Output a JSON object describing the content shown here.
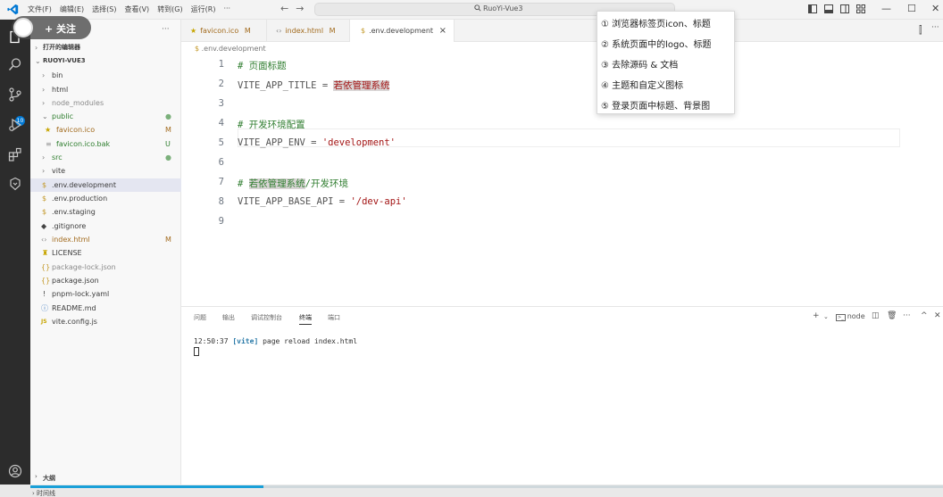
{
  "titlebar": {
    "menu": [
      "文件(F)",
      "编辑(E)",
      "选择(S)",
      "查看(V)",
      "转到(G)",
      "运行(R)",
      "···"
    ],
    "nav_back": "←",
    "nav_forward": "→",
    "search_label": "RuoYi-Vue3"
  },
  "follow_overlay": {
    "label": "+ 关注"
  },
  "sidebar": {
    "open_editors_label": "打开的编辑器",
    "project_label": "RUOYI-VUE3",
    "items": [
      {
        "label": "bin",
        "icon": "chevron-right",
        "status": ""
      },
      {
        "label": "html",
        "icon": "chevron-right",
        "status": ""
      },
      {
        "label": "node_modules",
        "icon": "chevron-right",
        "status": ""
      },
      {
        "label": "public",
        "icon": "chevron-down",
        "status": "●"
      },
      {
        "label": "favicon.ico",
        "icon": "star",
        "status": "M"
      },
      {
        "label": "favicon.ico.bak",
        "icon": "lines",
        "status": "U"
      },
      {
        "label": "src",
        "icon": "chevron-right",
        "status": "●"
      },
      {
        "label": "vite",
        "icon": "chevron-right",
        "status": ""
      },
      {
        "label": ".env.development",
        "icon": "dollar",
        "status": ""
      },
      {
        "label": ".env.production",
        "icon": "dollar",
        "status": ""
      },
      {
        "label": ".env.staging",
        "icon": "dollar",
        "status": ""
      },
      {
        "label": ".gitignore",
        "icon": "diamond",
        "status": ""
      },
      {
        "label": "index.html",
        "icon": "html",
        "status": "M"
      },
      {
        "label": "LICENSE",
        "icon": "license",
        "status": ""
      },
      {
        "label": "package-lock.json",
        "icon": "braces",
        "status": ""
      },
      {
        "label": "package.json",
        "icon": "braces",
        "status": ""
      },
      {
        "label": "pnpm-lock.yaml",
        "icon": "exclaim",
        "status": ""
      },
      {
        "label": "README.md",
        "icon": "info",
        "status": ""
      },
      {
        "label": "vite.config.js",
        "icon": "js",
        "status": ""
      }
    ],
    "outline_label": "大纲",
    "timeline_label": "时间线",
    "more": "···"
  },
  "tabs": [
    {
      "label": "favicon.ico",
      "status": "M"
    },
    {
      "label": "index.html",
      "status": "M"
    },
    {
      "label": ".env.development",
      "status": "×"
    }
  ],
  "breadcrumb": ".env.development",
  "editor": {
    "lines": [
      {
        "n": "1",
        "comment": "# 页面标题"
      },
      {
        "n": "2",
        "key": "VITE_APP_TITLE = ",
        "value": "若依管理系统"
      },
      {
        "n": "3"
      },
      {
        "n": "4",
        "comment": "# 开发环境配置"
      },
      {
        "n": "5",
        "key": "VITE_APP_ENV = ",
        "value": "'development'"
      },
      {
        "n": "6"
      },
      {
        "n": "7",
        "comment_pre": "# ",
        "comment_hl": "若依管理系统",
        "comment_post": "/开发环境"
      },
      {
        "n": "8",
        "key": "VITE_APP_BASE_API = ",
        "value": "'/dev-api'"
      },
      {
        "n": "9"
      }
    ]
  },
  "popup": {
    "items": [
      "① 浏览器标签页icon、标题",
      "② 系统页面中的logo、标题",
      "③ 去除源码 & 文档",
      "④ 主题和自定义图标",
      "⑤ 登录页面中标题、背景图"
    ]
  },
  "panel": {
    "tabs": [
      "问题",
      "输出",
      "调试控制台",
      "终端",
      "端口"
    ],
    "active_tab": "终端",
    "terminal_name": "node",
    "terminal_time": "12:50:37",
    "terminal_tag": "[vite]",
    "terminal_msg": " page reload index.html"
  },
  "progress": 0.255,
  "colors": {
    "accent": "#0078d4",
    "activity_bg": "#2c2c2c",
    "progress": "#1aa0d8"
  }
}
